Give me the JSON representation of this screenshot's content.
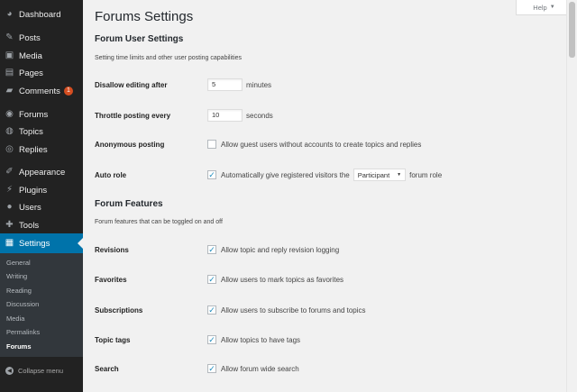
{
  "sidebar": {
    "dashboard": "Dashboard",
    "posts": "Posts",
    "media": "Media",
    "pages": "Pages",
    "comments": "Comments",
    "comments_badge": "1",
    "forums": "Forums",
    "topics": "Topics",
    "replies": "Replies",
    "appearance": "Appearance",
    "plugins": "Plugins",
    "users": "Users",
    "tools": "Tools",
    "settings": "Settings",
    "submenu": [
      "General",
      "Writing",
      "Reading",
      "Discussion",
      "Media",
      "Permalinks",
      "Forums"
    ],
    "collapse": "Collapse menu"
  },
  "help_tab": {
    "label": "Help",
    "arrow": "▼"
  },
  "page_title": "Forums Settings",
  "user_settings": {
    "title": "Forum User Settings",
    "desc": "Setting time limits and other user posting capabilities",
    "disallow_label": "Disallow editing after",
    "disallow_value": "5",
    "disallow_unit": "minutes",
    "throttle_label": "Throttle posting every",
    "throttle_value": "10",
    "throttle_unit": "seconds",
    "anon_label": "Anonymous posting",
    "anon_text": "Allow guest users without accounts to create topics and replies",
    "autorole_label": "Auto role",
    "autorole_text": "Automatically give registered visitors the",
    "autorole_select": "Participant",
    "autorole_suffix": "forum role"
  },
  "features": {
    "title": "Forum Features",
    "desc": "Forum features that can be toggled on and off",
    "revisions_label": "Revisions",
    "revisions_text": "Allow topic and reply revision logging",
    "favorites_label": "Favorites",
    "favorites_text": "Allow users to mark topics as favorites",
    "subscriptions_label": "Subscriptions",
    "subscriptions_text": "Allow users to subscribe to forums and topics",
    "tags_label": "Topic tags",
    "tags_text": "Allow topics to have tags",
    "search_label": "Search",
    "search_text": "Allow forum wide search"
  },
  "colors": {
    "sidebar_bg": "#222222",
    "submenu_bg": "#32373c",
    "accent": "#0073aa",
    "badge": "#d54e21",
    "content_bg": "#f1f1f1"
  }
}
